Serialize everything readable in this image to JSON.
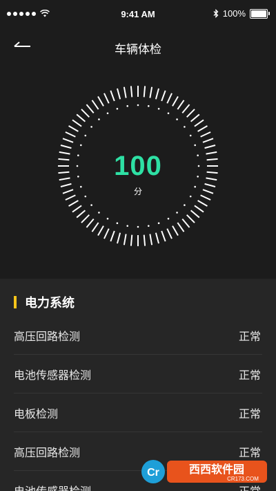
{
  "status_bar": {
    "time": "9:41 AM",
    "battery": "100%",
    "signal_icon": "signal-dots-icon",
    "wifi_icon": "wifi-icon",
    "bluetooth_icon": "bluetooth-icon",
    "battery_icon": "battery-icon"
  },
  "nav": {
    "title": "车辆体检",
    "back_icon": "back-arrow-icon"
  },
  "gauge": {
    "score": "100",
    "unit": "分",
    "score_color": "#2ee0a4"
  },
  "section": {
    "title": "电力系统",
    "accent_color": "#f5c41a",
    "items": [
      {
        "label": "高压回路检测",
        "status": "正常"
      },
      {
        "label": "电池传感器检测",
        "status": "正常"
      },
      {
        "label": "电板检测",
        "status": "正常"
      },
      {
        "label": "高压回路检测",
        "status": "正常"
      },
      {
        "label": "电池传感器检测",
        "status": "正常"
      }
    ]
  },
  "watermark": {
    "brand": "西西软件园",
    "site": "CR173.COM",
    "logo_text": "Cr"
  }
}
